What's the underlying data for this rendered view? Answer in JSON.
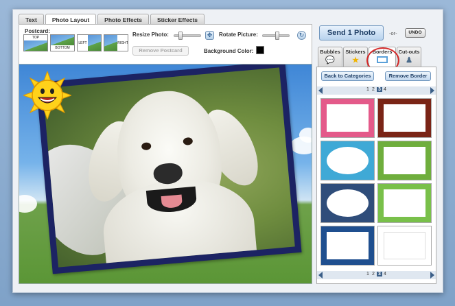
{
  "tabs": [
    {
      "label": "Text",
      "active": false
    },
    {
      "label": "Photo Layout",
      "active": true
    },
    {
      "label": "Photo Effects",
      "active": false
    },
    {
      "label": "Sticker Effects",
      "active": false
    }
  ],
  "toolbar": {
    "postcard_label": "Postcard:",
    "postcard_options": {
      "top": "TOP",
      "bottom": "BOTTOM",
      "left": "LEFT",
      "right": "RIGHT"
    },
    "resize_label": "Resize Photo:",
    "rotate_label": "Rotate Picture:",
    "remove_postcard_label": "Remove Postcard",
    "background_color_label": "Background Color:",
    "background_color": "#000000",
    "resize_level": 0.2,
    "rotate_level": 0.55
  },
  "actions": {
    "send_label": "Send 1 Photo",
    "or_label": "-or-",
    "undo_label": "UNDO"
  },
  "right_tabs": [
    {
      "label": "Bubbles",
      "icon": "speech-bubble-icon",
      "active": false
    },
    {
      "label": "Stickers",
      "icon": "star-icon",
      "active": false
    },
    {
      "label": "Borders",
      "icon": "border-frame-icon",
      "active": true
    },
    {
      "label": "Cut-outs",
      "icon": "person-cutout-icon",
      "active": false
    }
  ],
  "panel": {
    "back_label": "Back to Categories",
    "remove_border_label": "Remove Border",
    "pages": [
      "1",
      "2",
      "3",
      "4"
    ],
    "current_page": "3"
  },
  "borders": [
    {
      "name": "pink-border",
      "color": "#e45a8a"
    },
    {
      "name": "curtain-border",
      "color": "#7a2416"
    },
    {
      "name": "blue-cloud-border",
      "color": "#3fa9d6"
    },
    {
      "name": "green-frame-border",
      "color": "#6fae3d"
    },
    {
      "name": "night-sky-border",
      "color": "#2f4d7a"
    },
    {
      "name": "grass-soccer-border",
      "color": "#79c04a"
    },
    {
      "name": "blue-sun-border",
      "color": "#1f4f8f"
    },
    {
      "name": "white-orange-border",
      "color": "#f0f0f0"
    }
  ],
  "colors": {
    "accent": "#3b5f88",
    "frame": "#1c2363",
    "highlight_ring": "#d52b2b"
  }
}
